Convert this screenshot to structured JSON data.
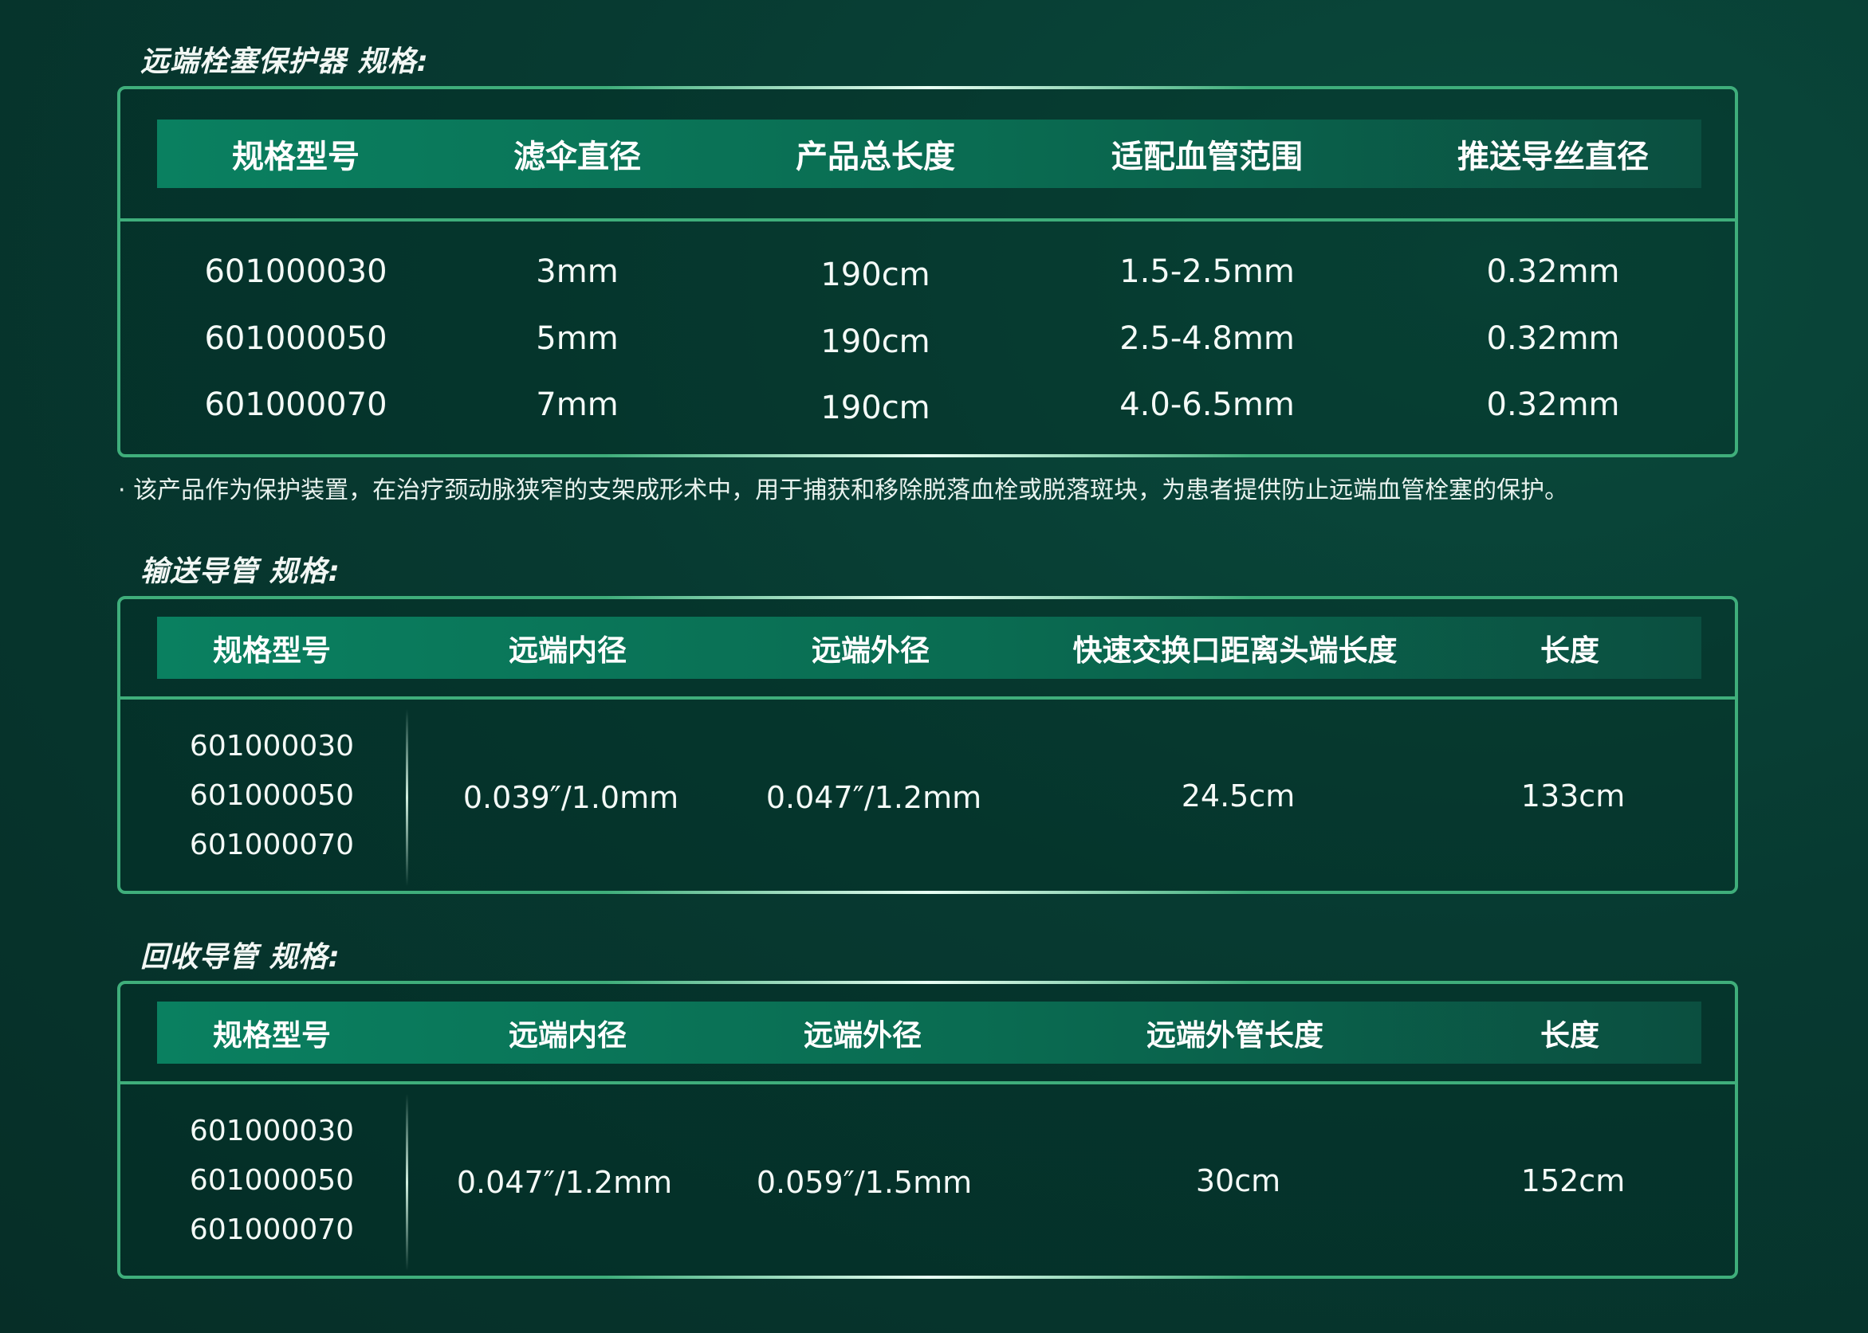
{
  "section1": {
    "title": "远端栓塞保护器 规格:",
    "headers": [
      "规格型号",
      "滤伞直径",
      "产品总长度",
      "适配血管范围",
      "推送导丝直径"
    ],
    "rows": [
      [
        "601000030",
        "3mm",
        "190cm",
        "1.5-2.5mm",
        "0.32mm"
      ],
      [
        "601000050",
        "5mm",
        "190cm",
        "2.5-4.8mm",
        "0.32mm"
      ],
      [
        "601000070",
        "7mm",
        "190cm",
        "4.0-6.5mm",
        "0.32mm"
      ]
    ]
  },
  "note": "·  该产品作为保护装置，在治疗颈动脉狭窄的支架成形术中，用于捕获和移除脱落血栓或脱落斑块，为患者提供防止远端血管栓塞的保护。",
  "section2": {
    "title": "输送导管 规格:",
    "headers": [
      "规格型号",
      "远端内径",
      "远端外径",
      "快速交换口距离头端长度",
      "长度"
    ],
    "models": [
      "601000030",
      "601000050",
      "601000070"
    ],
    "values": [
      "0.039″/1.0mm",
      "0.047″/1.2mm",
      "24.5cm",
      "133cm"
    ]
  },
  "section3": {
    "title": "回收导管 规格:",
    "headers": [
      "规格型号",
      "远端内径",
      "远端外径",
      "远端外管长度",
      "长度"
    ],
    "models": [
      "601000030",
      "601000050",
      "601000070"
    ],
    "values": [
      "0.047″/1.2mm",
      "0.059″/1.5mm",
      "30cm",
      "152cm"
    ]
  }
}
